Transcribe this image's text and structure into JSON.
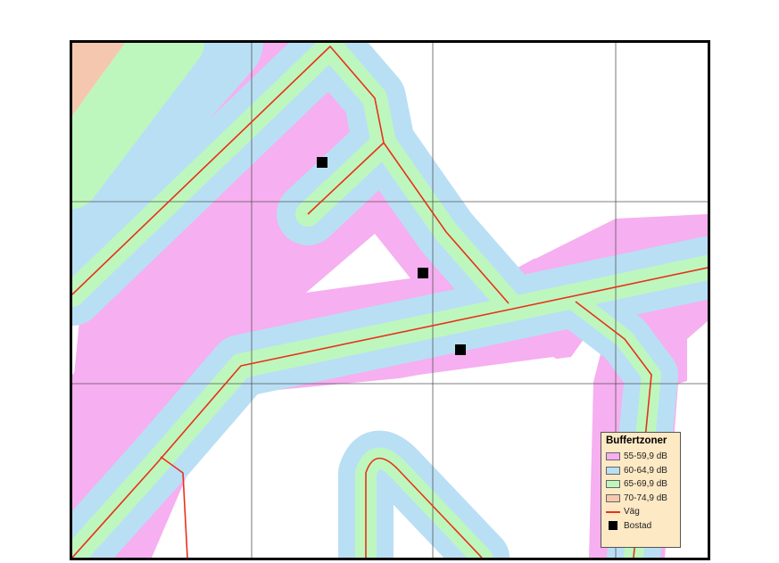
{
  "legend": {
    "title": "Buffertzoner",
    "items": [
      {
        "label": "55-59,9 dB",
        "color": "#f6aff0",
        "kind": "fill"
      },
      {
        "label": "60-64,9 dB",
        "color": "#b9dff5",
        "kind": "fill"
      },
      {
        "label": "65-69,9 dB",
        "color": "#bef7bd",
        "kind": "fill"
      },
      {
        "label": "70-74,9 dB",
        "color": "#f6c7af",
        "kind": "fill"
      },
      {
        "label": "Väg",
        "color": "#e8311b",
        "kind": "line"
      },
      {
        "label": "Bostad",
        "color": "#000000",
        "kind": "point"
      }
    ]
  },
  "colors": {
    "zone_55": "#f6aff0",
    "zone_60": "#b9dff5",
    "zone_65": "#bef7bd",
    "zone_70": "#f6c7af",
    "road": "#e8311b",
    "grid": "#555555",
    "background": "#ffffff"
  }
}
